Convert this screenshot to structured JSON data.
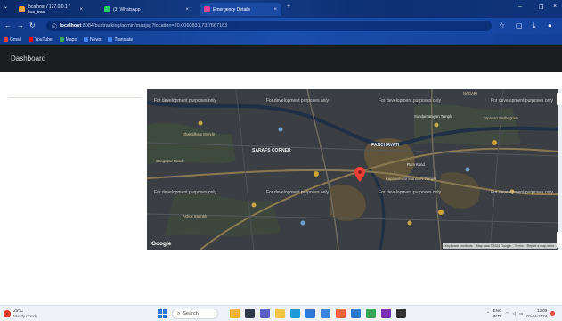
{
  "browser": {
    "tabs": [
      {
        "label": "localhost / 127.0.0.1 / bus_trac",
        "favicon_color": "#f0a53a",
        "active": false
      },
      {
        "label": "(3) WhatsApp",
        "favicon_color": "#25d366",
        "active": false
      },
      {
        "label": "Emergency Details",
        "favicon_color": "#e84393",
        "active": true
      }
    ],
    "new_tab": "+",
    "address": {
      "host": "localhost",
      "path": ":8084/bustracking/admin/mapjsp?location=20.0060831,73.7667183"
    },
    "bookmarks": [
      {
        "label": "Gmail",
        "color": "#ea4335"
      },
      {
        "label": "YouTube",
        "color": "#ff0000"
      },
      {
        "label": "Maps",
        "color": "#34a853"
      },
      {
        "label": "News",
        "color": "#4285f4"
      },
      {
        "label": "Translate",
        "color": "#4285f4"
      }
    ]
  },
  "app": {
    "brand": "Dashboard"
  },
  "map": {
    "watermark": "For development purposes only",
    "places": {
      "panchavati": "PANCHAVATI",
      "saraf": "SARAFS CORNER",
      "nagari": "NAGARI",
      "bhaktidham": "Bhaktidham Mandir",
      "sundarnarayan": "Sundarnarayan Temple",
      "tapovan": "Tapovan Sadhugram",
      "kapaleshwar": "Kapaleshwar Mahadev Temple",
      "ram_kund": "Ram Kund",
      "ashok_stambh": "Ashok Stambh",
      "gangapur": "Gangapur Road"
    },
    "google_logo": "Google",
    "attribution": [
      "Keyboard shortcuts",
      "Map data ©2024 Google",
      "Terms",
      "Report a map error"
    ],
    "pin_color": "#ea4335"
  },
  "taskbar": {
    "temp": "29°C",
    "weather": "Mostly cloudy",
    "search_placeholder": "Search",
    "lang": "ENG",
    "region": "INTL",
    "time": "13:09",
    "date": "01-04-2024",
    "apps": [
      {
        "name": "widgets",
        "color": "#f2b233"
      },
      {
        "name": "task-view",
        "color": "#2d3748"
      },
      {
        "name": "chat",
        "color": "#5b5fc7"
      },
      {
        "name": "explorer",
        "color": "#f5c542"
      },
      {
        "name": "edge",
        "color": "#1e9ad6"
      },
      {
        "name": "store",
        "color": "#2f7ad8"
      },
      {
        "name": "mail",
        "color": "#3a84e0"
      },
      {
        "name": "office",
        "color": "#e8663b"
      },
      {
        "name": "vscode",
        "color": "#2b7bd3"
      },
      {
        "name": "chrome",
        "color": "#34a853"
      },
      {
        "name": "onenote",
        "color": "#7b2fb5"
      },
      {
        "name": "terminal",
        "color": "#333333"
      }
    ]
  }
}
